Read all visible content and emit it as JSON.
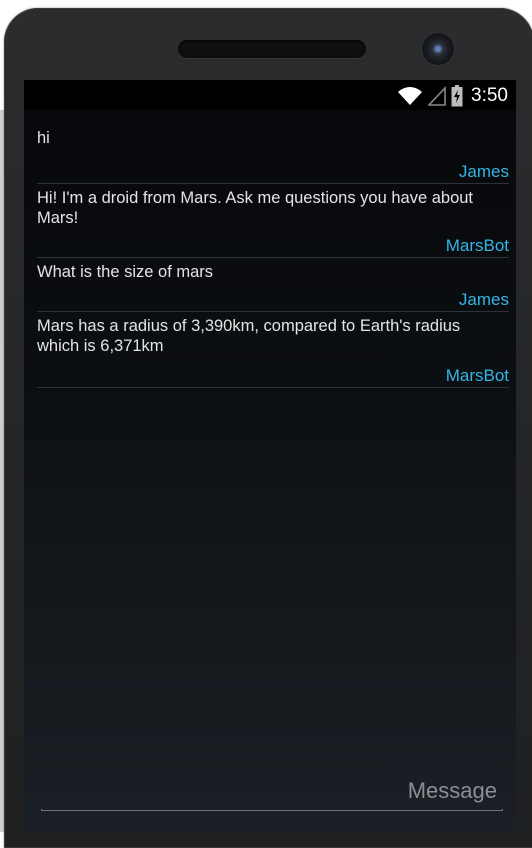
{
  "status_bar": {
    "time": "3:50",
    "icons": [
      "wifi-icon",
      "signal-icon",
      "battery-icon"
    ]
  },
  "messages": [
    {
      "text": "hi",
      "author": "James"
    },
    {
      "text": "Hi! I'm a droid from Mars. Ask me questions you have about Mars!",
      "author": "MarsBot"
    },
    {
      "text": "What is the size of mars",
      "author": "James"
    },
    {
      "text": "Mars has a radius of 3,390km, compared to Earth's radius which is 6,371km",
      "author": "MarsBot"
    }
  ],
  "composer": {
    "placeholder": "Message",
    "value": ""
  },
  "colors": {
    "accent": "#33b5e5",
    "text": "#e4e4e4",
    "background": "#0c0f12"
  }
}
